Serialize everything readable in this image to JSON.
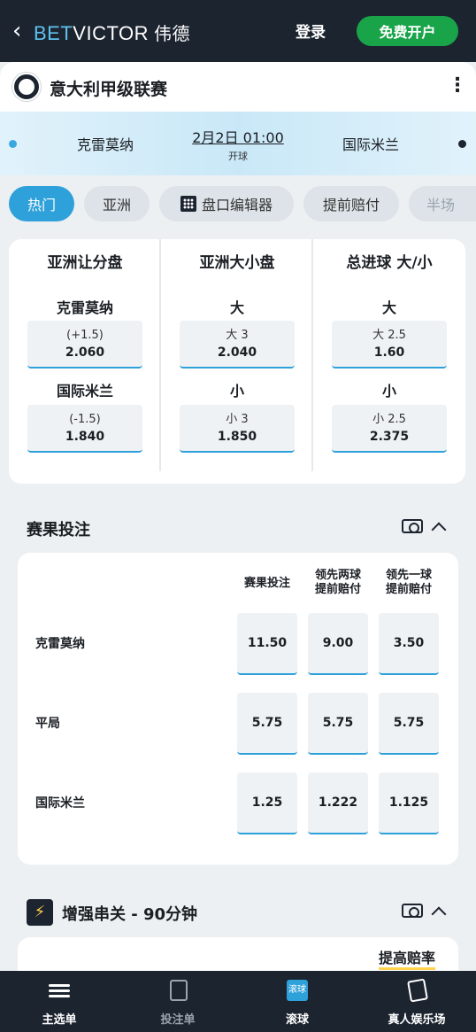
{
  "header": {
    "logo_bet": "BET",
    "logo_victor": "VICTOR",
    "logo_cn": "伟德",
    "login": "登录",
    "signup": "免费开户"
  },
  "league": {
    "title": "意大利甲级联赛"
  },
  "match": {
    "home": "克雷莫纳",
    "away": "国际米兰",
    "time": "2月2日 01:00",
    "status": "开球"
  },
  "tabs": [
    "热门",
    "亚洲",
    "盘口编辑器",
    "提前赔付",
    "半场"
  ],
  "handicap": {
    "cols": [
      {
        "title": "亚洲让分盘",
        "row1": "克雷莫纳",
        "row2": "国际米兰",
        "o1_line": "(+1.5)",
        "o1_price": "2.060",
        "o2_line": "(-1.5)",
        "o2_price": "1.840"
      },
      {
        "title": "亚洲大小盘",
        "row1": "大",
        "row2": "小",
        "o1_line": "大 3",
        "o1_price": "2.040",
        "o2_line": "小 3",
        "o2_price": "1.850"
      },
      {
        "title": "总进球 大/小",
        "row1": "大",
        "row2": "小",
        "o1_line": "大 2.5",
        "o1_price": "1.60",
        "o2_line": "小 2.5",
        "o2_price": "2.375"
      }
    ]
  },
  "result": {
    "title": "赛果投注",
    "col1": "赛果投注",
    "col2a": "领先两球",
    "col2b": "提前赔付",
    "col3a": "领先一球",
    "col3b": "提前赔付",
    "rows": [
      {
        "label": "克雷莫纳",
        "odds": [
          "11.50",
          "9.00",
          "3.50"
        ]
      },
      {
        "label": "平局",
        "odds": [
          "5.75",
          "5.75",
          "5.75"
        ]
      },
      {
        "label": "国际米兰",
        "odds": [
          "1.25",
          "1.222",
          "1.125"
        ]
      }
    ]
  },
  "boost_section": {
    "title": "增强串关 - 90分钟",
    "boost_label": "提高赔率",
    "bolt": "⚡"
  },
  "nav": {
    "main": "主选单",
    "betslip": "投注单",
    "live": "滚球",
    "live_icon": "滚球",
    "casino": "真人娱乐场"
  }
}
